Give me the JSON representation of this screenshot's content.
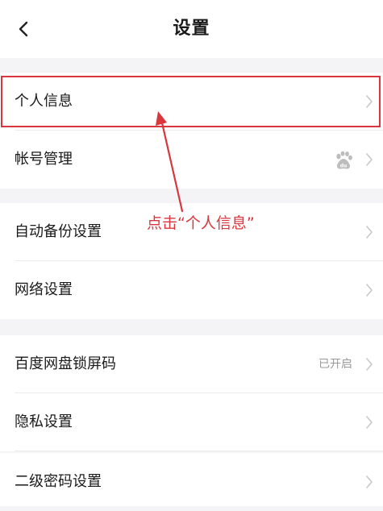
{
  "header": {
    "title": "设置",
    "back_icon": "chevron-left-icon"
  },
  "rows": [
    {
      "label": "个人信息"
    },
    {
      "label": "帐号管理",
      "icon": "baidu-paw-icon"
    },
    {
      "label": "自动备份设置"
    },
    {
      "label": "网络设置"
    },
    {
      "label": "百度网盘锁屏码",
      "value": "已开启"
    },
    {
      "label": "隐私设置"
    },
    {
      "label": "二级密码设置"
    }
  ],
  "annotation": {
    "text": "点击“个人信息”",
    "color": "#d9363e"
  },
  "colors": {
    "background": "#f4f4f6",
    "row_background": "#ffffff",
    "chevron": "#c8c8c8",
    "secondary_text": "#999999"
  }
}
